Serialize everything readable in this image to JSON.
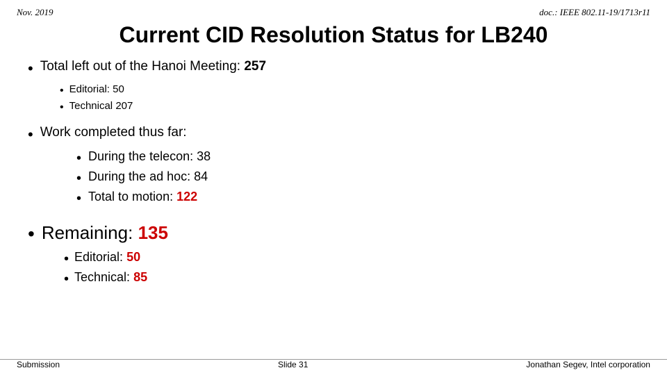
{
  "header": {
    "left": "Nov. 2019",
    "right": "doc.: IEEE 802.11-19/1713r11"
  },
  "title": "Current CID Resolution Status for LB240",
  "bullets": {
    "total_label": "Total left out of the Hanoi Meeting:",
    "total_value": "257",
    "sub1_label": "Editorial:",
    "sub1_value": "50",
    "sub2_label": "Technical",
    "sub2_value": "207",
    "work_label": "Work completed thus far:",
    "work_sub1_label": "During the telecon:",
    "work_sub1_value": "38",
    "work_sub2_label": "During the ad hoc:",
    "work_sub2_value": "84",
    "work_sub3_label": "Total to motion:",
    "work_sub3_value": "122",
    "remaining_label": "Remaining:",
    "remaining_value": "135",
    "rem_sub1_label": "Editorial:",
    "rem_sub1_value": "50",
    "rem_sub2_label": "Technical:",
    "rem_sub2_value": "85"
  },
  "footer": {
    "left": "Submission",
    "center": "Slide 31",
    "right": "Jonathan Segev, Intel corporation"
  }
}
